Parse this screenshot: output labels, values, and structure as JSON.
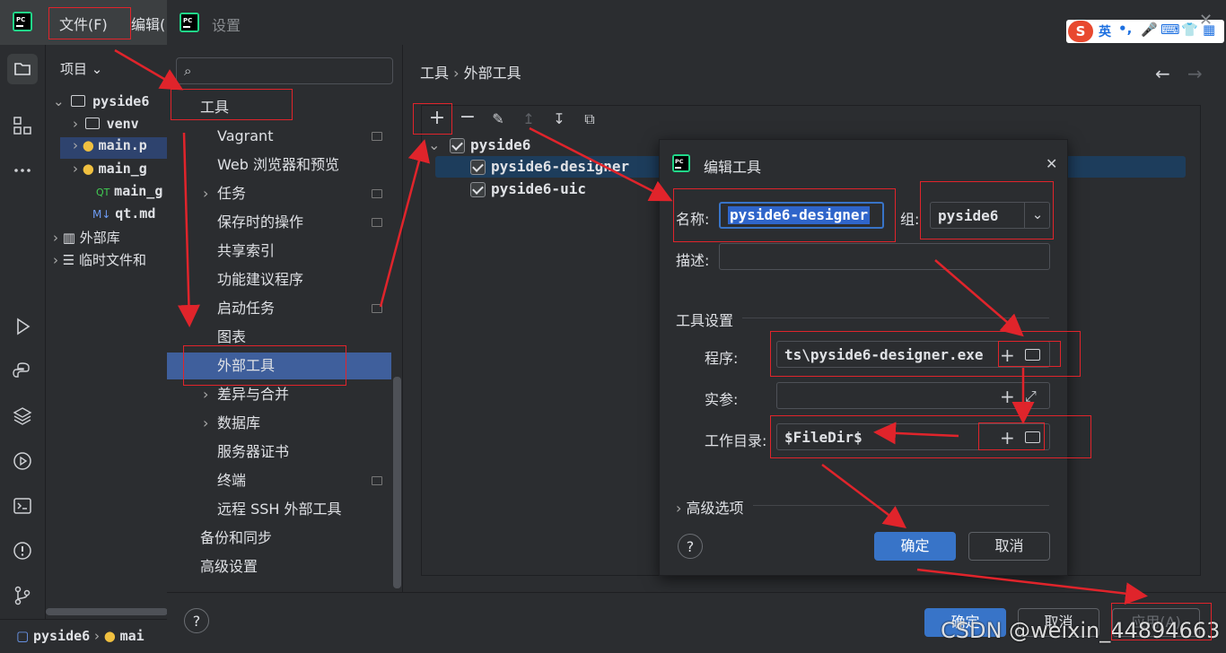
{
  "ide": {
    "menu": {
      "file": "文件(F)",
      "edit": "编辑("
    },
    "project_label": "项目",
    "tree": [
      {
        "label": "pyside6",
        "kind": "folder"
      },
      {
        "label": "venv",
        "kind": "folder"
      },
      {
        "label": "main.p",
        "kind": "python"
      },
      {
        "label": "main_g",
        "kind": "python"
      },
      {
        "label": "main_g",
        "kind": "qt"
      },
      {
        "label": "qt.md",
        "kind": "markdown"
      },
      {
        "label": "外部库",
        "kind": "library"
      },
      {
        "label": "临时文件和",
        "kind": "scratch"
      }
    ],
    "statusbar": {
      "project": "pyside6",
      "file": "mai"
    }
  },
  "settings": {
    "title": "设置",
    "breadcrumb": {
      "parent": "工具",
      "current": "外部工具"
    },
    "nav": [
      {
        "label": "工具",
        "level": 0,
        "has_mark": false
      },
      {
        "label": "Vagrant",
        "level": 1,
        "has_mark": true
      },
      {
        "label": "Web 浏览器和预览",
        "level": 1,
        "has_mark": false
      },
      {
        "label": "任务",
        "level": 1,
        "has_mark": true,
        "expandable": true
      },
      {
        "label": "保存时的操作",
        "level": 1,
        "has_mark": true
      },
      {
        "label": "共享索引",
        "level": 1,
        "has_mark": false
      },
      {
        "label": "功能建议程序",
        "level": 1,
        "has_mark": false
      },
      {
        "label": "启动任务",
        "level": 1,
        "has_mark": true
      },
      {
        "label": "图表",
        "level": 1,
        "has_mark": false
      },
      {
        "label": "外部工具",
        "level": 1,
        "has_mark": false,
        "selected": true
      },
      {
        "label": "差异与合并",
        "level": 1,
        "has_mark": false,
        "expandable": true
      },
      {
        "label": "数据库",
        "level": 1,
        "has_mark": false,
        "expandable": true
      },
      {
        "label": "服务器证书",
        "level": 1,
        "has_mark": false
      },
      {
        "label": "终端",
        "level": 1,
        "has_mark": true
      },
      {
        "label": "远程 SSH 外部工具",
        "level": 1,
        "has_mark": false
      },
      {
        "label": "备份和同步",
        "level": 0,
        "has_mark": false
      },
      {
        "label": "高级设置",
        "level": 0,
        "has_mark": false
      }
    ],
    "tools_tree": {
      "group": "pyside6",
      "items": [
        "pyside6-designer",
        "pyside6-uic"
      ]
    },
    "footer": {
      "ok": "确定",
      "cancel": "取消",
      "apply": "应用(A)"
    }
  },
  "edit_tool_dialog": {
    "title": "编辑工具",
    "name_label": "名称:",
    "name_value": "pyside6-designer",
    "group_label": "组:",
    "group_value": "pyside6",
    "description_label": "描述:",
    "description_value": "",
    "section_tool_settings": "工具设置",
    "program_label": "程序:",
    "program_value": "ts\\pyside6-designer.exe",
    "arguments_label": "实参:",
    "arguments_value": "",
    "workdir_label": "工作目录:",
    "workdir_value": "$FileDir$",
    "advanced_label": "高级选项",
    "ok": "确定",
    "cancel": "取消",
    "help": "?"
  },
  "ime": {
    "lang": "英"
  },
  "watermark": "CSDN @weixin_44894663",
  "colors": {
    "accent": "#3874c8",
    "selection": "#3f5f9c",
    "annotation": "#e0242b"
  }
}
